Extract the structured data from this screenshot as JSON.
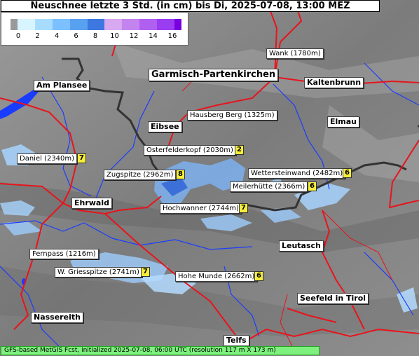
{
  "title": "Neuschnee letzte 3 Std. (in cm) bis Di, 2025-07-08, 13:00 MEZ",
  "legend": {
    "ticks": [
      "0",
      "2",
      "4",
      "6",
      "8",
      "10",
      "12",
      "14",
      "16"
    ],
    "colors": [
      "#9a9a9a",
      "#d8f4ff",
      "#a8dcff",
      "#7cc0ff",
      "#58a0f0",
      "#3c78e0",
      "#d8a8f0",
      "#c484f0",
      "#b060f0",
      "#9a3cf0",
      "#7a00e0"
    ]
  },
  "places": [
    {
      "name": "Wank (1780m)",
      "kind": "peak"
    },
    {
      "name": "Garmisch-Partenkirchen",
      "kind": "big"
    },
    {
      "name": "Kaltenbrunn",
      "kind": "town"
    },
    {
      "name": "Am Plansee",
      "kind": "town"
    },
    {
      "name": "Hausberg Berg (1325m)",
      "kind": "peak"
    },
    {
      "name": "Eibsee",
      "kind": "town"
    },
    {
      "name": "Elmau",
      "kind": "town"
    },
    {
      "name": "Osterfelderkopf (2030m)",
      "kind": "peak",
      "value": "2"
    },
    {
      "name": "Daniel (2340m)",
      "kind": "peak",
      "value": "7"
    },
    {
      "name": "Zugspitze (2962m)",
      "kind": "peak",
      "value": "8"
    },
    {
      "name": "Wettersteinwand (2482m)",
      "kind": "peak",
      "value": "6"
    },
    {
      "name": "Meilerhütte (2366m)",
      "kind": "peak",
      "value": "6"
    },
    {
      "name": "Ehrwald",
      "kind": "towncap"
    },
    {
      "name": "Hochwanner (2744m)",
      "kind": "peak",
      "value": "7"
    },
    {
      "name": "Leutasch",
      "kind": "towncap"
    },
    {
      "name": "Fernpass (1216m)",
      "kind": "peak"
    },
    {
      "name": "W. Griesspitze (2741m)",
      "kind": "peak",
      "value": "7"
    },
    {
      "name": "Hohe Munde (2662m)",
      "kind": "peak",
      "value": "6"
    },
    {
      "name": "Seefeld in Tirol",
      "kind": "towncap"
    },
    {
      "name": "Nassereith",
      "kind": "towncap"
    },
    {
      "name": "Telfs",
      "kind": "towncap"
    }
  ],
  "footer": "GFS-based MetGIS Fcst, initialized 2025-07-08, 06:00 UTC  (resolution 117 m X 173 m)",
  "colors": {
    "road": "#e8141c",
    "river": "#1a3cff",
    "border": "#333333",
    "terrain": "#8a8a8a"
  }
}
